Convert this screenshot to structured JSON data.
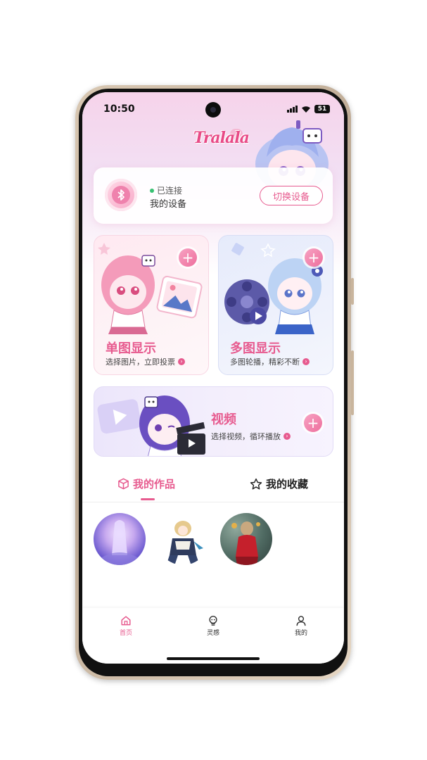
{
  "status_bar": {
    "time": "10:50",
    "battery": "51"
  },
  "app": {
    "brand": "Tralala"
  },
  "device_card": {
    "connection_status": "已连接",
    "device_name": "我的设备",
    "switch_button": "切换设备"
  },
  "features": {
    "single": {
      "title": "单图显示",
      "subtitle": "选择图片，立即投票"
    },
    "multi": {
      "title": "多图显示",
      "subtitle": "多图轮播，精彩不断"
    },
    "video": {
      "title": "视频",
      "subtitle": "选择视频，循环播放"
    },
    "plus_symbol": "+"
  },
  "tabs": [
    {
      "label": "我的作品",
      "icon": "cube-icon",
      "active": true
    },
    {
      "label": "我的收藏",
      "icon": "star-icon",
      "active": false
    }
  ],
  "bottom_nav": [
    {
      "label": "首页",
      "icon": "home-icon",
      "active": true
    },
    {
      "label": "灵感",
      "icon": "bulb-icon",
      "active": false
    },
    {
      "label": "我的",
      "icon": "user-icon",
      "active": false
    }
  ],
  "colors": {
    "accent": "#e75b8f",
    "connected": "#38c172"
  }
}
